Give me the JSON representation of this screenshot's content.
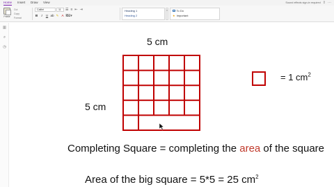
{
  "menu": {
    "tabs": [
      "Home",
      "Insert",
      "Draw",
      "View"
    ],
    "active": "Home",
    "hint": "Sound effects sign-in required"
  },
  "ribbon": {
    "paste_label": "Paste",
    "clipboard_items": [
      "Cut",
      "Copy",
      "Format"
    ],
    "font_name": "Calibri",
    "font_size": "11",
    "styles": [
      "Heading 1",
      "Heading 2"
    ],
    "tags": [
      "To Do",
      "Important"
    ]
  },
  "page": {
    "top_label": "5 cm",
    "side_label": "5 cm",
    "unit_equation": "= 1 cm",
    "unit_power": "2",
    "title_prefix": "Completing Square = completing the ",
    "title_accent": "area",
    "title_suffix": " of the square",
    "area_equation": "Area of the big square = 5*5 = 25 cm",
    "area_power": "2"
  },
  "colors": {
    "grid_red": "#c00000",
    "accent_text": "#c0392b",
    "active_tab": "#7719aa"
  },
  "grid": {
    "columns": 5,
    "rows": 5,
    "unit_square_count": 1
  }
}
